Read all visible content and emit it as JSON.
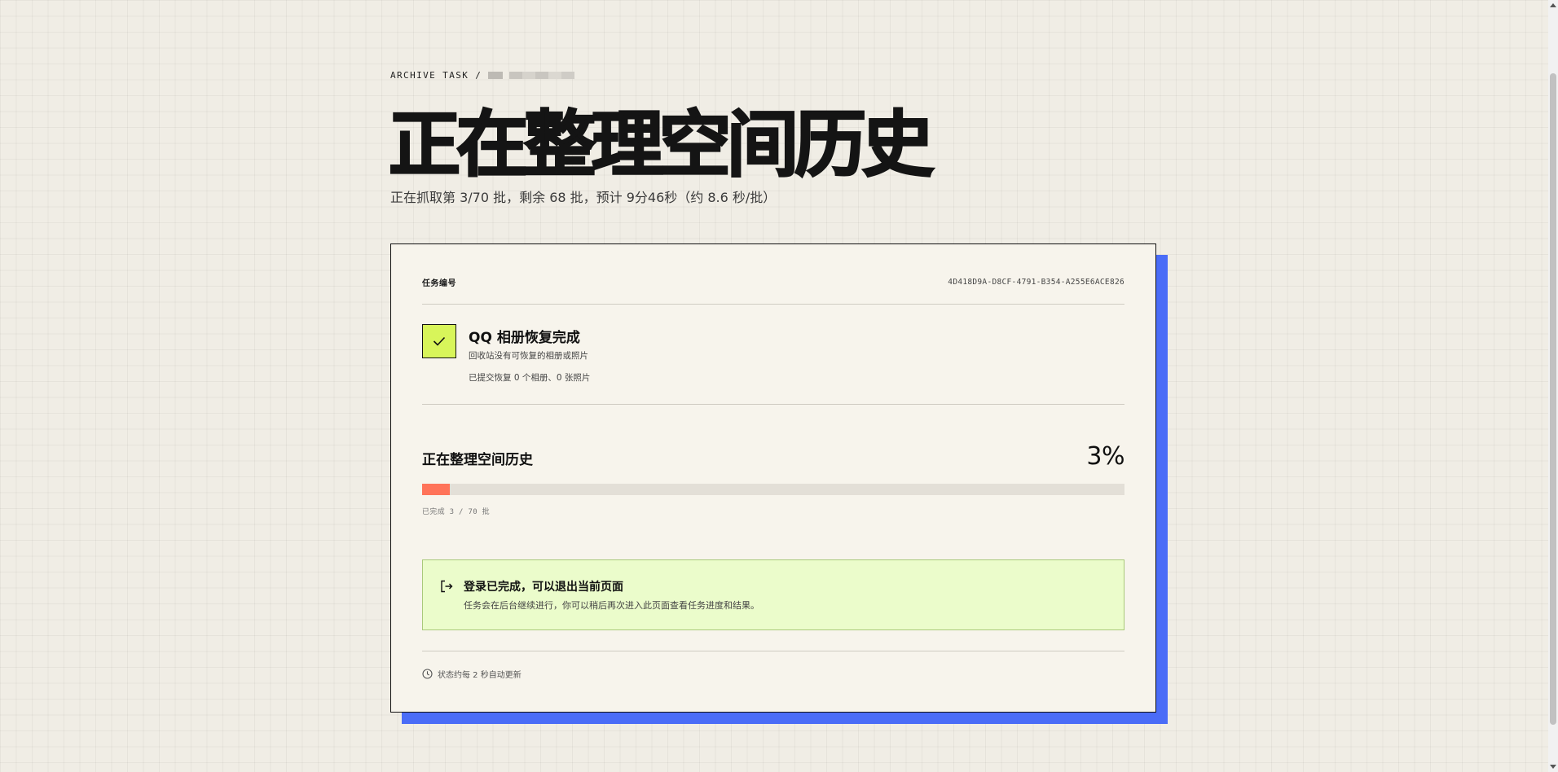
{
  "breadcrumb": {
    "label": "ARCHIVE TASK",
    "separator": "/"
  },
  "hero": {
    "title": "正在整理空间历史",
    "subtitle": "正在抓取第 3/70 批，剩余 68 批，预计 9分46秒（约 8.6 秒/批）"
  },
  "task": {
    "id_label": "任务编号",
    "id_value": "4D418D9A-D8CF-4791-B354-A255E6ACE826"
  },
  "recovery": {
    "icon": "check-icon",
    "title": "QQ 相册恢复完成",
    "description": "回收站没有可恢复的相册或照片",
    "summary": "已提交恢复 0 个相册、0 张照片"
  },
  "progress": {
    "title": "正在整理空间历史",
    "percent_label": "3%",
    "fraction": 0.04,
    "caption": "已完成 3 / 70 批"
  },
  "notice": {
    "icon": "exit-icon",
    "title": "登录已完成，可以退出当前页面",
    "body": "任务会在后台继续进行，你可以稍后再次进入此页面查看任务进度和结果。"
  },
  "footer": {
    "icon": "clock-icon",
    "text": "状态约每 2 秒自动更新"
  },
  "colors": {
    "accent_blue": "#4a6cf7",
    "check_green": "#d8f55a",
    "progress_fill": "#ff7359",
    "notice_bg": "#ebfccb"
  }
}
